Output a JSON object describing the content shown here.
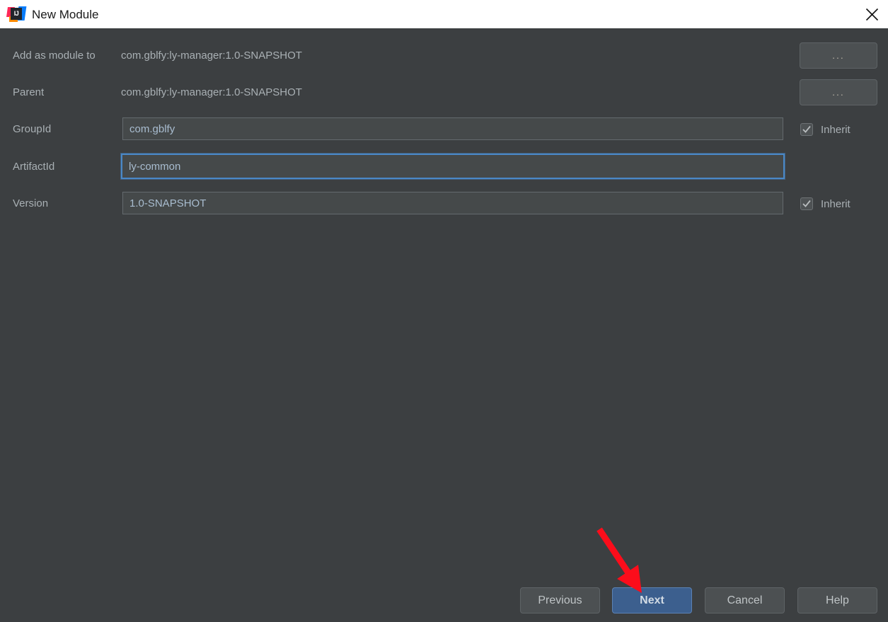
{
  "window": {
    "title": "New Module",
    "logo_text": "IJ",
    "logo_icon": "intellij-idea-logo",
    "close_icon": "close-icon"
  },
  "form": {
    "rows": [
      {
        "label": "Add as module to",
        "value": "com.gblfy:ly-manager:1.0-SNAPSHOT",
        "type": "static",
        "browse_label": "..."
      },
      {
        "label": "Parent",
        "value": "com.gblfy:ly-manager:1.0-SNAPSHOT",
        "type": "static",
        "browse_label": "..."
      },
      {
        "label": "GroupId",
        "value": "com.gblfy",
        "type": "input",
        "inherit_label": "Inherit",
        "inherit_checked": true
      },
      {
        "label": "ArtifactId",
        "value": "ly-common",
        "type": "input",
        "focused": true
      },
      {
        "label": "Version",
        "value": "1.0-SNAPSHOT",
        "type": "input",
        "inherit_label": "Inherit",
        "inherit_checked": true
      }
    ]
  },
  "footer": {
    "previous_label": "Previous",
    "next_label": "Next",
    "cancel_label": "Cancel",
    "help_label": "Help"
  },
  "annotation": {
    "arrow_color": "#fc0d1b",
    "arrow_target": "next-button"
  },
  "colors": {
    "background": "#3c3f41",
    "titlebar": "#ffffff",
    "field_background": "#45494a",
    "field_border": "#646a6e",
    "focus_border": "#4a88c7",
    "primary_button": "#3c5f8e",
    "text": "#a9b0b4",
    "value_text": "#a9bdd0"
  }
}
